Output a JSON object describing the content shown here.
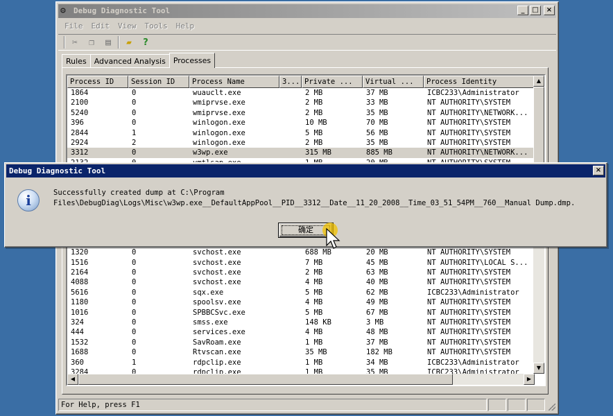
{
  "window": {
    "title": "Debug Diagnostic Tool",
    "buttons": {
      "minimize": "_",
      "maximize": "□",
      "close": "×"
    }
  },
  "menu": [
    "File",
    "Edit",
    "View",
    "Tools",
    "Help"
  ],
  "toolbar_icons": [
    "cut-icon",
    "copy-icon",
    "paste-icon",
    "open-folder-icon",
    "help-icon"
  ],
  "tabs": [
    {
      "label": "Rules",
      "active": false
    },
    {
      "label": "Advanced Analysis",
      "active": false
    },
    {
      "label": "Processes",
      "active": true
    }
  ],
  "table": {
    "columns": [
      "Process ID",
      "Session ID",
      "Process Name",
      "3...",
      "Private ...",
      "Virtual ...",
      "Process Identity"
    ],
    "rows": [
      [
        "1864",
        "0",
        "wuauclt.exe",
        "",
        "2 MB",
        "37 MB",
        "ICBC233\\Administrator"
      ],
      [
        "2100",
        "0",
        "wmiprvse.exe",
        "",
        "2 MB",
        "33 MB",
        "NT AUTHORITY\\SYSTEM"
      ],
      [
        "5240",
        "0",
        "wmiprvse.exe",
        "",
        "2 MB",
        "35 MB",
        "NT AUTHORITY\\NETWORK..."
      ],
      [
        "396",
        "0",
        "winlogon.exe",
        "",
        "10 MB",
        "70 MB",
        "NT AUTHORITY\\SYSTEM"
      ],
      [
        "2844",
        "1",
        "winlogon.exe",
        "",
        "5 MB",
        "56 MB",
        "NT AUTHORITY\\SYSTEM"
      ],
      [
        "2924",
        "2",
        "winlogon.exe",
        "",
        "2 MB",
        "35 MB",
        "NT AUTHORITY\\SYSTEM"
      ],
      [
        "3312",
        "0",
        "w3wp.exe",
        "",
        "315 MB",
        "885 MB",
        "NT AUTHORITY\\NETWORK..."
      ],
      [
        "2132",
        "0",
        "vmtlsap.exe",
        "",
        "1 MB",
        "20 MB",
        "NT AUTHORITY\\SYSTEM"
      ],
      [
        "",
        "",
        "",
        "",
        "",
        "",
        ""
      ],
      [
        "",
        "",
        "",
        "",
        "",
        "",
        ""
      ],
      [
        "",
        "",
        "",
        "",
        "",
        "",
        ""
      ],
      [
        "",
        "",
        "",
        "",
        "",
        "",
        ""
      ],
      [
        "",
        "",
        "",
        "",
        "",
        "",
        ""
      ],
      [
        "",
        "",
        "",
        "",
        "",
        "",
        ""
      ],
      [
        "",
        "",
        "",
        "",
        "",
        "",
        ""
      ],
      [
        "",
        "",
        "",
        "",
        "",
        "",
        ""
      ],
      [
        "1320",
        "0",
        "svchost.exe",
        "",
        "688 MB",
        "20 MB",
        "NT AUTHORITY\\SYSTEM"
      ],
      [
        "1516",
        "0",
        "svchost.exe",
        "",
        "7 MB",
        "45 MB",
        "NT AUTHORITY\\LOCAL S..."
      ],
      [
        "2164",
        "0",
        "svchost.exe",
        "",
        "2 MB",
        "63 MB",
        "NT AUTHORITY\\SYSTEM"
      ],
      [
        "4088",
        "0",
        "svchost.exe",
        "",
        "4 MB",
        "40 MB",
        "NT AUTHORITY\\SYSTEM"
      ],
      [
        "5616",
        "0",
        "sqx.exe",
        "",
        "5 MB",
        "62 MB",
        "ICBC233\\Administrator"
      ],
      [
        "1180",
        "0",
        "spoolsv.exe",
        "",
        "4 MB",
        "49 MB",
        "NT AUTHORITY\\SYSTEM"
      ],
      [
        "1016",
        "0",
        "SPBBCSvc.exe",
        "",
        "5 MB",
        "67 MB",
        "NT AUTHORITY\\SYSTEM"
      ],
      [
        "324",
        "0",
        "smss.exe",
        "",
        "148 KB",
        "3 MB",
        "NT AUTHORITY\\SYSTEM"
      ],
      [
        "444",
        "0",
        "services.exe",
        "",
        "4 MB",
        "48 MB",
        "NT AUTHORITY\\SYSTEM"
      ],
      [
        "1532",
        "0",
        "SavRoam.exe",
        "",
        "1 MB",
        "37 MB",
        "NT AUTHORITY\\SYSTEM"
      ],
      [
        "1688",
        "0",
        "Rtvscan.exe",
        "",
        "35 MB",
        "182 MB",
        "NT AUTHORITY\\SYSTEM"
      ],
      [
        "360",
        "1",
        "rdpclip.exe",
        "",
        "1 MB",
        "34 MB",
        "ICBC233\\Administrator"
      ],
      [
        "3284",
        "0",
        "rdpclip.exe",
        "",
        "1 MB",
        "35 MB",
        "ICBC233\\Administrator"
      ]
    ],
    "selected_row": 6
  },
  "status": {
    "text": "For Help, press F1"
  },
  "dialog": {
    "title": "Debug Diagnostic Tool",
    "close": "×",
    "icon": "info-icon",
    "icon_glyph": "i",
    "message_line1": "Successfully created dump at C:\\Program",
    "message_line2": "Files\\DebugDiag\\Logs\\Misc\\w3wp.exe__DefaultAppPool__PID__3312__Date__11_20_2008__Time_03_51_54PM__760__Manual Dump.dmp.",
    "ok_label": "确定"
  },
  "colors": {
    "desktop": "#3a6ea5",
    "dialog_title": "#0a246a",
    "selected_row": "#d4d0c8"
  }
}
